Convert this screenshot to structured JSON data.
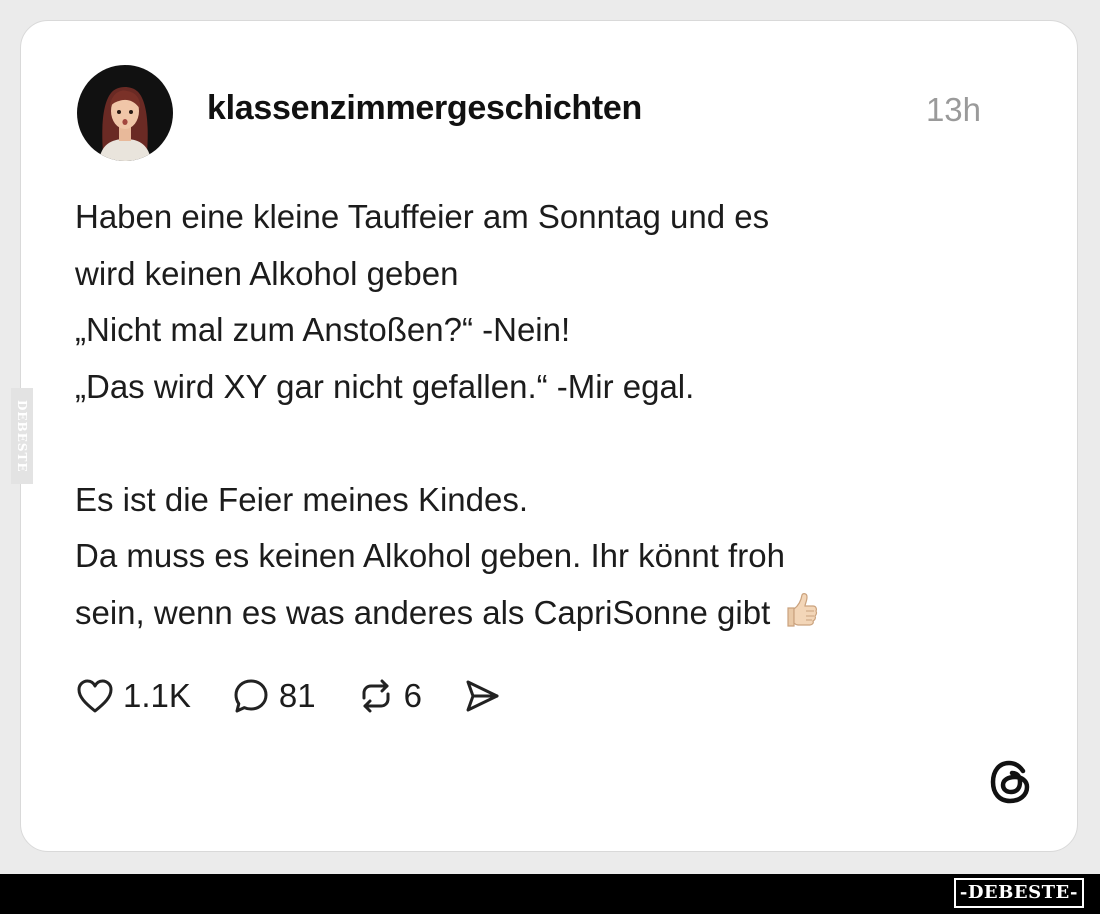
{
  "post": {
    "username": "klassenzimmergeschichten",
    "timestamp": "13h",
    "lines": [
      "Haben eine kleine Tauffeier am Sonntag und es",
      "wird keinen Alkohol geben",
      "„Nicht mal zum Anstoßen?“ -Nein!",
      "„Das wird XY gar nicht gefallen.“ -Mir egal.",
      "Es ist die Feier meines Kindes.",
      "Da muss es keinen Alkohol geben. Ihr könnt froh",
      "sein, wenn es was anderes als CapriSonne gibt"
    ],
    "emoji": "thumbs-up"
  },
  "actions": {
    "likes": "1.1K",
    "comments": "81",
    "reposts": "6"
  },
  "icons": {
    "like": "heart-icon",
    "comment": "comment-bubble-icon",
    "repost": "repost-icon",
    "share": "send-icon",
    "brand": "threads-logo-icon"
  },
  "watermark": {
    "side": "DEBESTE",
    "bottom": "-DEBESTE-"
  },
  "colors": {
    "background": "#ebebeb",
    "card": "#ffffff",
    "text": "#1c1c1c",
    "muted": "#9a9a9a",
    "bottom_bar": "#000000"
  }
}
